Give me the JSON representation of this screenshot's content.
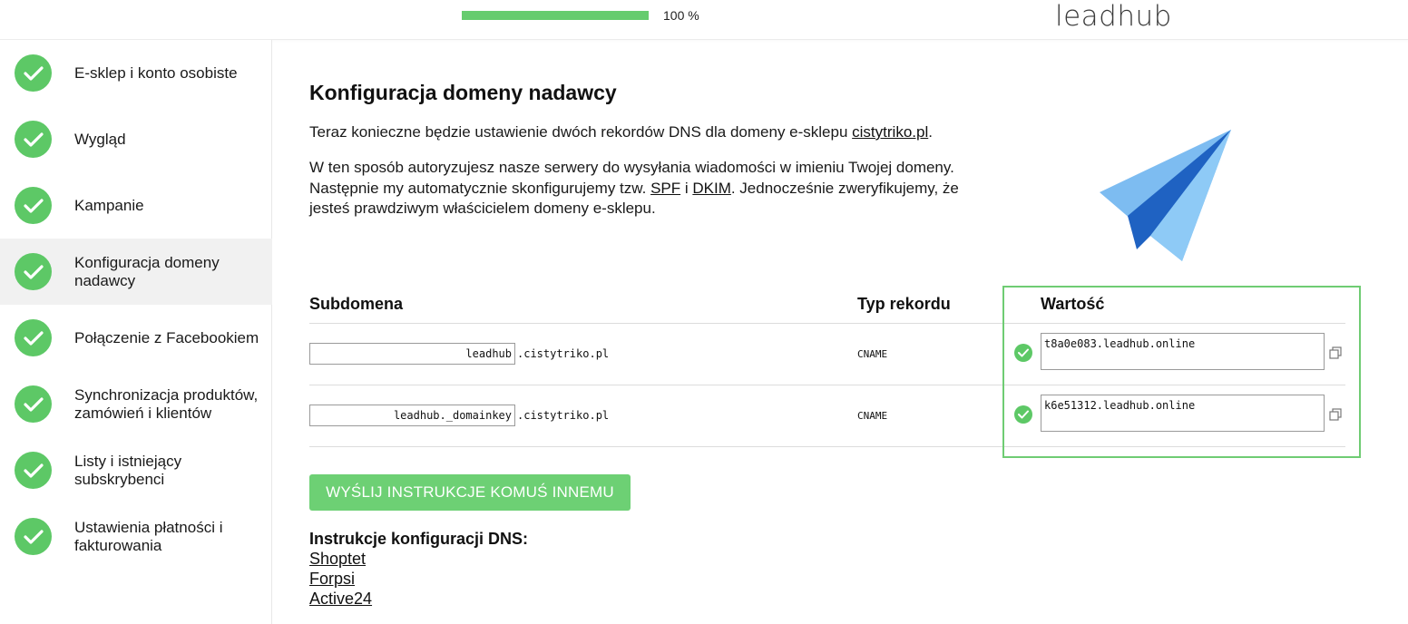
{
  "header": {
    "progress_label": "100 %",
    "progress_fraction": 1.0,
    "logo": "leadhub"
  },
  "sidebar": {
    "items": [
      {
        "label": "E-sklep i konto osobiste",
        "completed": true
      },
      {
        "label": "Wygląd",
        "completed": true
      },
      {
        "label": "Kampanie",
        "completed": true
      },
      {
        "label": "Konfiguracja domeny nadawcy",
        "completed": true,
        "active": true
      },
      {
        "label": "Połączenie z Facebookiem",
        "completed": true
      },
      {
        "label": "Synchronizacja produktów, zamówień i klientów",
        "completed": true
      },
      {
        "label": "Listy i istniejący subskrybenci",
        "completed": true
      },
      {
        "label": "Ustawienia płatności i fakturowania",
        "completed": true
      }
    ]
  },
  "main": {
    "title": "Konfiguracja domeny nadawcy",
    "intro_before": "Teraz konieczne będzie ustawienie dwóch rekordów DNS dla domeny e-sklepu ",
    "intro_domain": "cistytriko.pl",
    "intro_after": ".",
    "explain_line1": "W ten sposób autoryzujesz nasze serwery do wysyłania wiadomości w imieniu Twojej domeny.",
    "explain_line2_before": "Następnie my automatycznie skonfigurujemy tzw. ",
    "explain_spf": "SPF",
    "explain_and": " i ",
    "explain_dkim": "DKIM",
    "explain_line2_after": ". Jednocześnie zweryfikujemy, że",
    "explain_line3": "jesteś prawdziwym właścicielem domeny e-sklepu."
  },
  "table": {
    "headers": {
      "subdomain": "Subdomena",
      "type": "Typ rekordu",
      "value": "Wartość"
    },
    "rows": [
      {
        "subdomain": "leadhub",
        "suffix": ".cistytriko.pl",
        "type": "CNAME",
        "value": "t8a0e083.leadhub.online",
        "verified": true
      },
      {
        "subdomain": "leadhub._domainkey",
        "suffix": ".cistytriko.pl",
        "type": "CNAME",
        "value": "k6e51312.leadhub.online",
        "verified": true
      }
    ]
  },
  "cta": {
    "label": "WYŚLIJ INSTRUKCJE KOMUŚ INNEMU"
  },
  "dns": {
    "heading": "Instrukcje konfiguracji DNS:",
    "links": [
      "Shoptet",
      "Forpsi",
      "Active24"
    ]
  },
  "colors": {
    "accent": "#5dc866",
    "highlight_border": "#6fcc73",
    "plane_light": "#7dbcf1",
    "plane_dark": "#1f62c2"
  },
  "icons": {
    "step": "check-circle-icon",
    "copy": "copy-icon",
    "illustration": "paper-plane-icon"
  }
}
